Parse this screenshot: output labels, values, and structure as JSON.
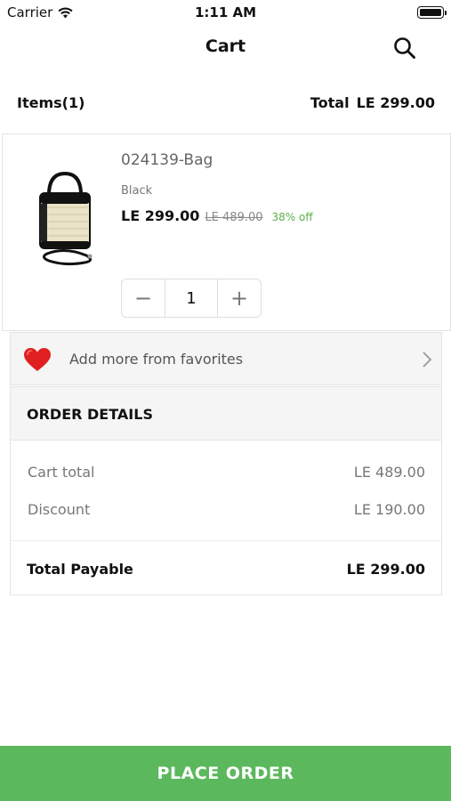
{
  "status_bar": {
    "carrier": "Carrier",
    "time": "1:11 AM"
  },
  "nav": {
    "title": "Cart",
    "search_icon": "search-icon"
  },
  "summary": {
    "items_label": "Items(1)",
    "total_label": "Total",
    "total_value": "LE 299.00"
  },
  "product": {
    "name": "024139-Bag",
    "color": "Black",
    "price": "LE 299.00",
    "old_price": "LE 489.00",
    "discount": "38% off",
    "quantity": "1",
    "minus_label": "−",
    "plus_label": "+"
  },
  "favorites": {
    "label": "Add more from favorites",
    "icon": "heart-icon",
    "heart_color": "#e02020"
  },
  "order_details": {
    "title": "ORDER DETAILS",
    "cart_total_label": "Cart total",
    "cart_total_value": "LE 489.00",
    "discount_label": "Discount",
    "discount_value": "LE 190.00",
    "payable_label": "Total Payable",
    "payable_value": "LE 299.00"
  },
  "footer": {
    "place_order_label": "PLACE ORDER",
    "button_color": "#5cb85c"
  },
  "colors": {
    "discount_green": "#5bb04a"
  }
}
